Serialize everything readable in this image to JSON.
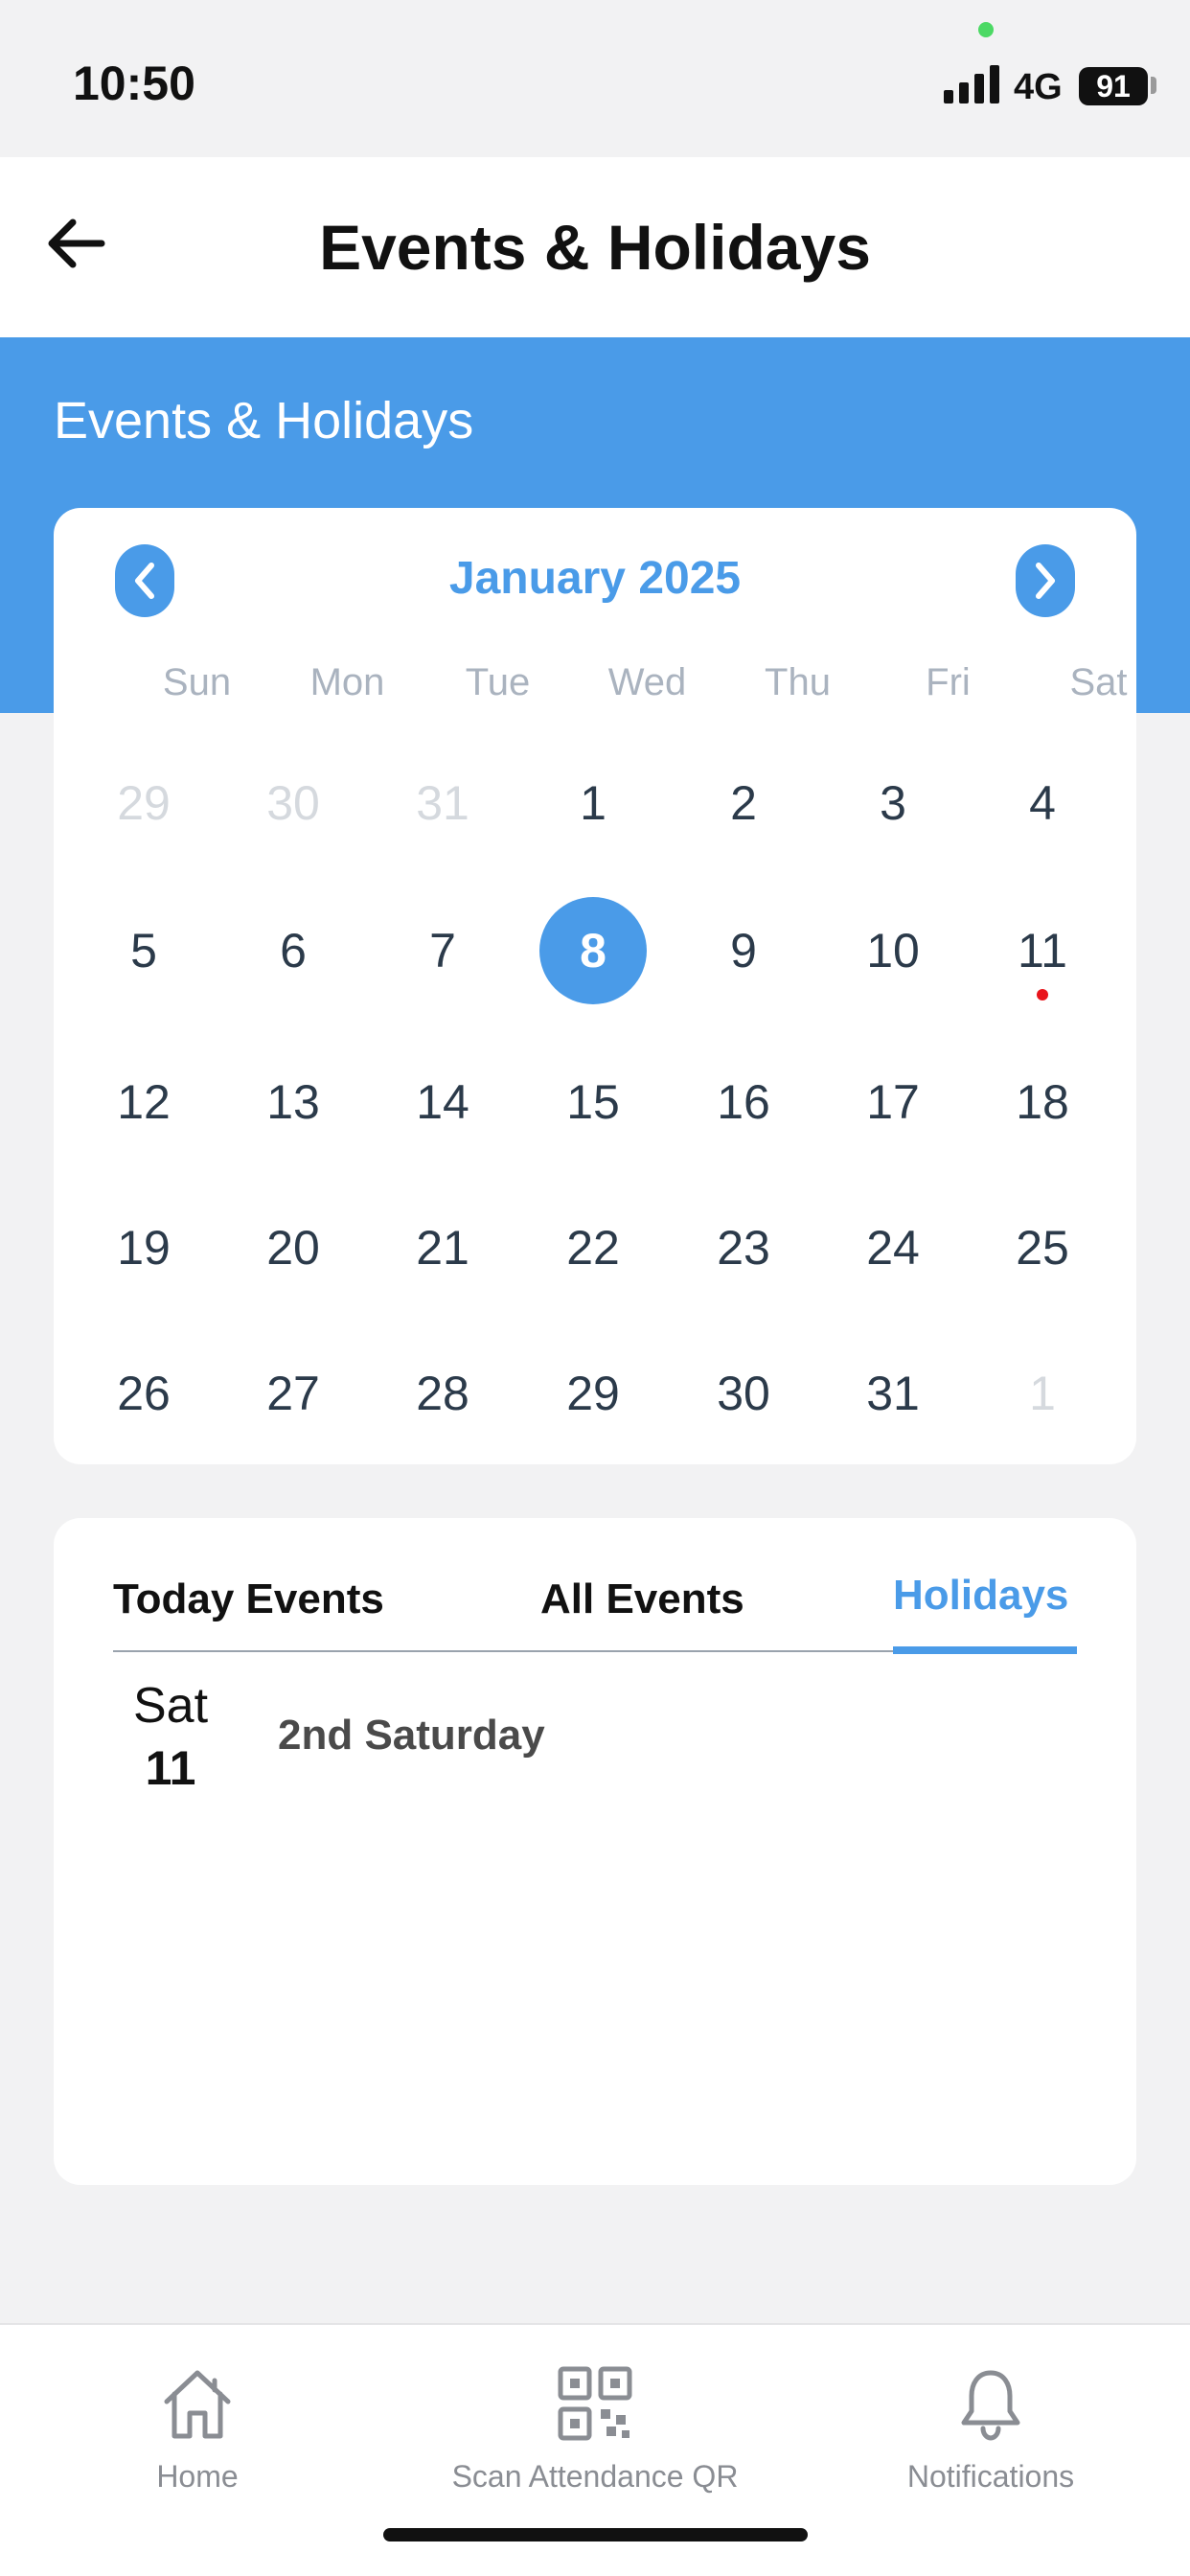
{
  "status_bar": {
    "time": "10:50",
    "network": "4G",
    "battery": "91"
  },
  "header": {
    "title": "Events & Holidays",
    "back_icon": "arrow-left-icon"
  },
  "section": {
    "title": "Events & Holidays"
  },
  "calendar": {
    "month_label": "January 2025",
    "prev_icon": "chevron-left-icon",
    "next_icon": "chevron-right-icon",
    "weekdays": [
      "Sun",
      "Mon",
      "Tue",
      "Wed",
      "Thu",
      "Fri",
      "Sat"
    ],
    "weeks": [
      [
        "29",
        "30",
        "31",
        "1",
        "2",
        "3",
        "4"
      ],
      [
        "5",
        "6",
        "7",
        "8",
        "9",
        "10",
        "11"
      ],
      [
        "12",
        "13",
        "14",
        "15",
        "16",
        "17",
        "18"
      ],
      [
        "19",
        "20",
        "21",
        "22",
        "23",
        "24",
        "25"
      ],
      [
        "26",
        "27",
        "28",
        "29",
        "30",
        "31",
        "1"
      ]
    ],
    "selected_day": "8",
    "event_days": [
      "11"
    ],
    "accent_color": "#4a9be8",
    "event_dot_color": "#e8141b"
  },
  "tabs": {
    "today": "Today Events",
    "all": "All Events",
    "holidays": "Holidays",
    "active": "Holidays"
  },
  "holidays": [
    {
      "weekday": "Sat",
      "date": "11",
      "name": "2nd Saturday"
    }
  ],
  "bottom_nav": [
    {
      "label": "Home",
      "icon": "home-icon"
    },
    {
      "label": "Scan Attendance QR",
      "icon": "qr-code-icon"
    },
    {
      "label": "Notifications",
      "icon": "bell-icon"
    }
  ]
}
